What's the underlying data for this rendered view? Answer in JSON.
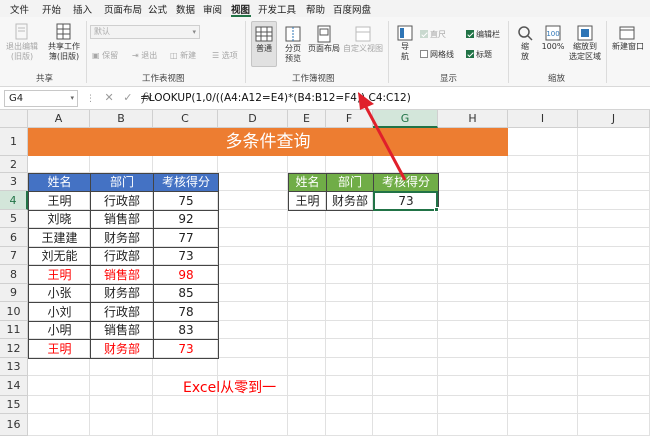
{
  "menu": {
    "items": [
      "文件",
      "开始",
      "插入",
      "页面布局",
      "公式",
      "数据",
      "审阅",
      "视图",
      "开发工具",
      "帮助",
      "百度网盘"
    ],
    "active": "视图"
  },
  "ribbon": {
    "share": {
      "exit_edit": "退出编辑\n(旧版)",
      "shared_workbook": "共享工作\n簿(旧版)",
      "group": "共享"
    },
    "sheet_view": {
      "dropdown": "默认",
      "keep": "保留",
      "exit": "退出",
      "new": "新建",
      "options": "选项",
      "group": "工作表视图"
    },
    "workbook_view": {
      "normal": "普通",
      "page_break": "分页\n预览",
      "page_layout": "页面布局",
      "custom": "自定义视图",
      "group": "工作簿视图"
    },
    "show": {
      "navigation": "导\n航",
      "ruler": "直尺",
      "gridlines": "网格线",
      "formula_bar": "编辑栏",
      "headings": "标题",
      "group": "显示"
    },
    "zoom": {
      "zoom": "缩\n放",
      "hundred": "100%",
      "zoom_selection": "缩放到\n选定区域",
      "group": "缩放"
    },
    "window": {
      "new_window": "新建窗口"
    }
  },
  "formula_bar": {
    "name_box": "G4",
    "formula": "=LOOKUP(1,0/((A4:A12=E4)*(B4:B12=F4)),C4:C12)"
  },
  "columns": [
    "A",
    "B",
    "C",
    "D",
    "E",
    "F",
    "G",
    "H",
    "I",
    "J"
  ],
  "rows": [
    "1",
    "2",
    "3",
    "4",
    "5",
    "6",
    "7",
    "8",
    "9",
    "10",
    "11",
    "12",
    "13",
    "14",
    "15",
    "16"
  ],
  "sheet": {
    "title": "多条件查询",
    "headers": [
      "姓名",
      "部门",
      "考核得分"
    ],
    "data": [
      {
        "name": "王明",
        "dept": "行政部",
        "score": "75",
        "highlight": false
      },
      {
        "name": "刘晓",
        "dept": "销售部",
        "score": "92",
        "highlight": false
      },
      {
        "name": "王建建",
        "dept": "财务部",
        "score": "77",
        "highlight": false
      },
      {
        "name": "刘无能",
        "dept": "行政部",
        "score": "73",
        "highlight": false
      },
      {
        "name": "王明",
        "dept": "销售部",
        "score": "98",
        "highlight": true
      },
      {
        "name": "小张",
        "dept": "财务部",
        "score": "85",
        "highlight": false
      },
      {
        "name": "小刘",
        "dept": "行政部",
        "score": "78",
        "highlight": false
      },
      {
        "name": "小明",
        "dept": "销售部",
        "score": "83",
        "highlight": false
      },
      {
        "name": "王明",
        "dept": "财务部",
        "score": "73",
        "highlight": true
      }
    ],
    "lookup": {
      "headers": [
        "姓名",
        "部门",
        "考核得分"
      ],
      "name": "王明",
      "dept": "财务部",
      "result": "73"
    },
    "watermark": "Excel从零到一"
  },
  "colors": {
    "title_bg": "#ed7d31",
    "blue_header": "#4472c4",
    "green_header": "#70ad47",
    "highlight_red": "#ff0000",
    "excel_green": "#217346"
  }
}
